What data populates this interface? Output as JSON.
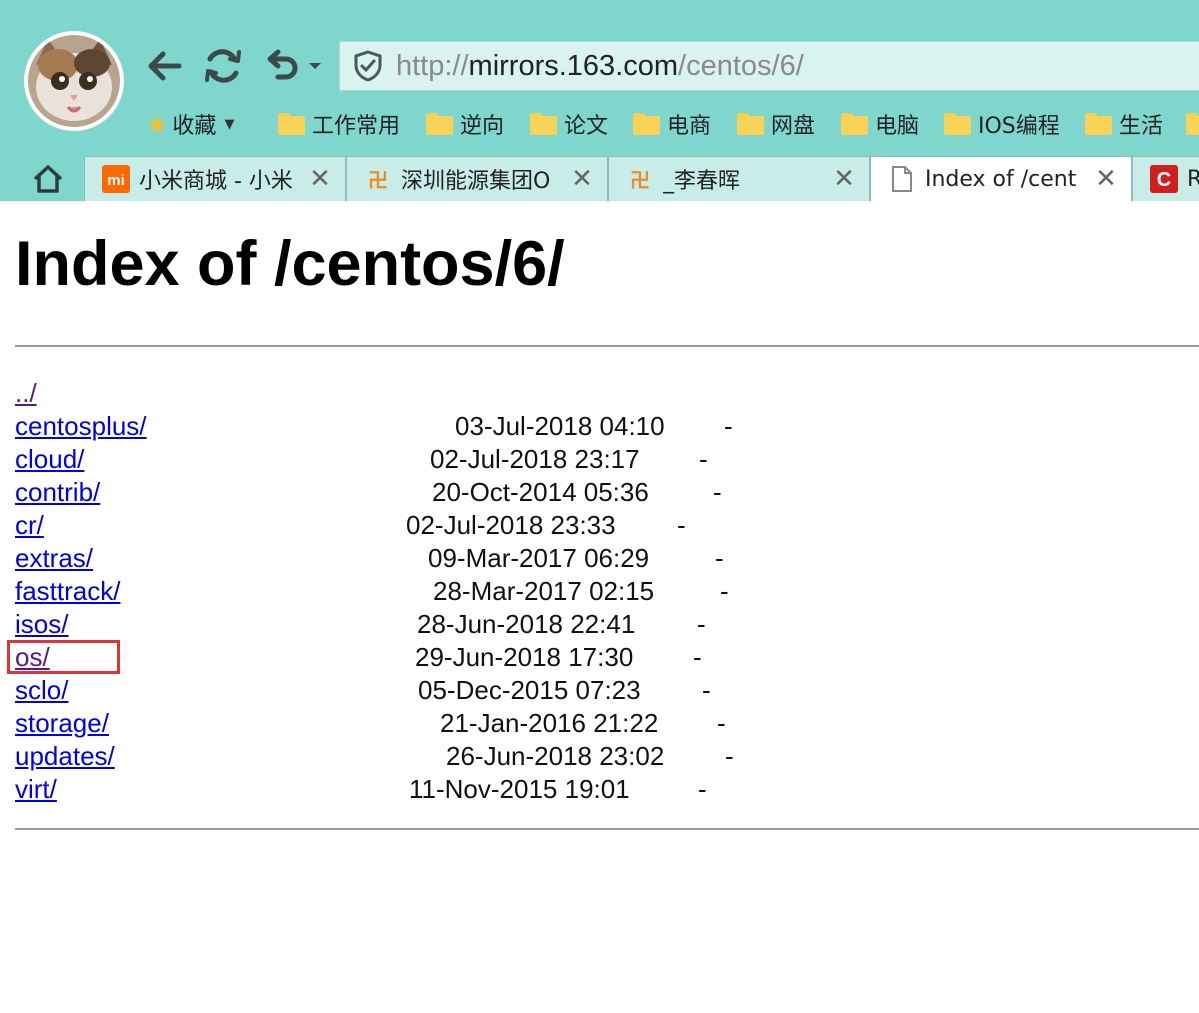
{
  "browser": {
    "url_scheme": "http://",
    "url_host": "mirrors.163.com",
    "url_path": "/centos/6/",
    "bookmarks": [
      {
        "label": "收藏",
        "icon": "star-icon"
      },
      {
        "label": "工作常用",
        "icon": "folder-icon"
      },
      {
        "label": "逆向",
        "icon": "folder-icon"
      },
      {
        "label": "论文",
        "icon": "folder-icon"
      },
      {
        "label": "电商",
        "icon": "folder-icon"
      },
      {
        "label": "网盘",
        "icon": "folder-icon"
      },
      {
        "label": "电脑",
        "icon": "folder-icon"
      },
      {
        "label": "IOS编程",
        "icon": "folder-icon"
      },
      {
        "label": "生活",
        "icon": "folder-icon"
      }
    ],
    "tabs": [
      {
        "title": "小米商城 - 小米",
        "icon": "mi-logo-icon"
      },
      {
        "title": "深圳能源集团O",
        "icon": "site-logo-icon"
      },
      {
        "title": "_李春晖",
        "icon": "site-logo-icon"
      },
      {
        "title": "Index of /cent",
        "icon": "page-icon"
      },
      {
        "title": "R",
        "icon": "c-logo-icon"
      }
    ],
    "colors": {
      "chrome": "#7fd6cd",
      "address_bar": "#d9f3ef",
      "highlight": "#e23434"
    }
  },
  "page": {
    "title": "Index of /centos/6/",
    "parent_link": "../",
    "entries": [
      {
        "name": "centosplus/",
        "date": "03-Jul-2018 04:10",
        "size": "-"
      },
      {
        "name": "cloud/",
        "date": "02-Jul-2018 23:17",
        "size": "-"
      },
      {
        "name": "contrib/",
        "date": "20-Oct-2014 05:36",
        "size": "-"
      },
      {
        "name": "cr/",
        "date": "02-Jul-2018 23:33",
        "size": "-"
      },
      {
        "name": "extras/",
        "date": "09-Mar-2017 06:29",
        "size": "-"
      },
      {
        "name": "fasttrack/",
        "date": "28-Mar-2017 02:15",
        "size": "-"
      },
      {
        "name": "isos/",
        "date": "28-Jun-2018 22:41",
        "size": "-"
      },
      {
        "name": "os/",
        "date": "29-Jun-2018 17:30",
        "size": "-"
      },
      {
        "name": "sclo/",
        "date": "05-Dec-2015 07:23",
        "size": "-"
      },
      {
        "name": "storage/",
        "date": "21-Jan-2016 21:22",
        "size": "-"
      },
      {
        "name": "updates/",
        "date": "26-Jun-2018 23:02",
        "size": "-"
      },
      {
        "name": "virt/",
        "date": "11-Nov-2015 19:01",
        "size": "-"
      }
    ]
  }
}
